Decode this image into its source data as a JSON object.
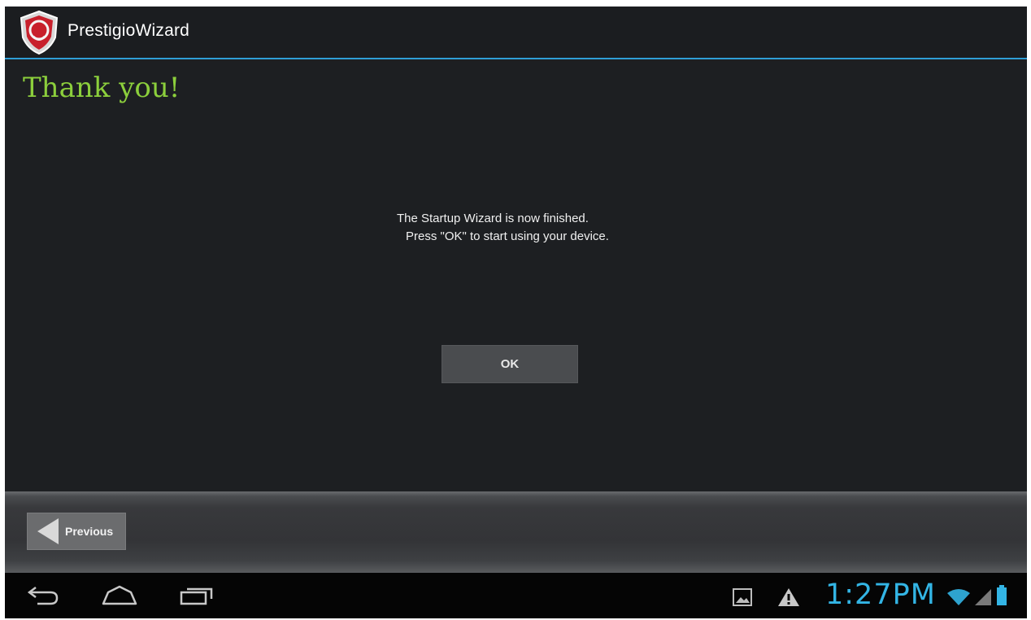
{
  "app": {
    "title": "PrestigioWizard",
    "accent_color": "#2f9ed6",
    "icon": "prestigio-logo-icon"
  },
  "main": {
    "heading": "Thank you!",
    "heading_color": "#8ccf3c",
    "message_line1": "The Startup Wizard is now finished.",
    "message_line2": "Press \"OK\" to start using your device.",
    "ok_label": "OK"
  },
  "wizard_nav": {
    "previous_label": "Previous",
    "previous_icon": "arrow-left-icon"
  },
  "system_bar": {
    "back_icon": "back-icon",
    "home_icon": "home-icon",
    "recents_icon": "recent-apps-icon",
    "notification_icons": [
      "gallery-icon",
      "warning-icon"
    ],
    "time": "1:27PM",
    "status_icons": [
      "wifi-icon",
      "signal-icon",
      "battery-icon"
    ],
    "status_color": "#33b5e5"
  }
}
